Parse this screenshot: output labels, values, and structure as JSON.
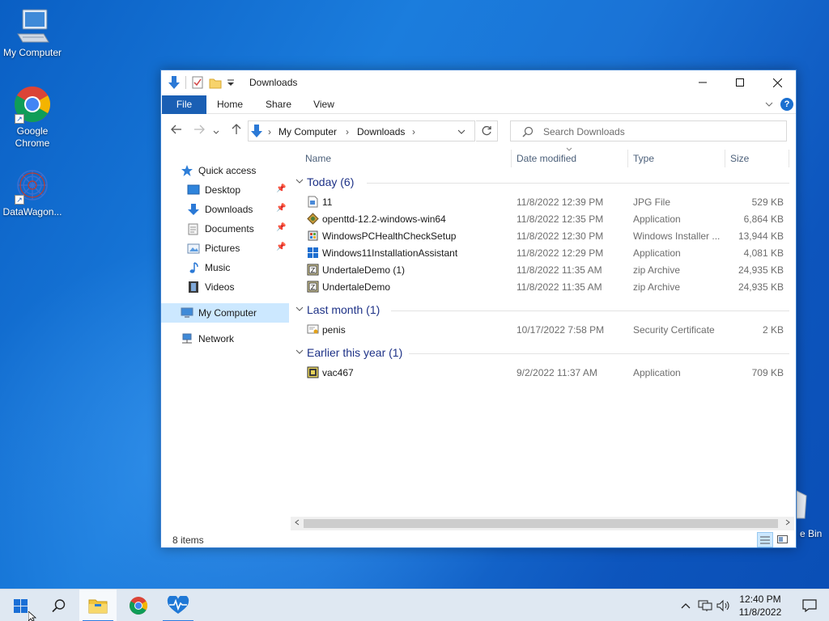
{
  "desktop": {
    "icons": [
      {
        "label": "My Computer"
      },
      {
        "label": "Google Chrome"
      },
      {
        "label": "DataWagon..."
      }
    ],
    "recycle_bin_label": "e Bin"
  },
  "window": {
    "title": "Downloads",
    "ribbon_tabs": [
      "File",
      "Home",
      "Share",
      "View"
    ],
    "help_glyph": "?",
    "address": {
      "crumbs": [
        "My Computer",
        "Downloads"
      ]
    },
    "search": {
      "placeholder": "Search Downloads"
    },
    "nav": {
      "quick_access": "Quick access",
      "items": [
        "Desktop",
        "Downloads",
        "Documents",
        "Pictures",
        "Music",
        "Videos"
      ],
      "my_computer": "My Computer",
      "network": "Network"
    },
    "columns": [
      "Name",
      "Date modified",
      "Type",
      "Size"
    ],
    "groups": [
      {
        "title": "Today (6)",
        "files": [
          {
            "name": "11",
            "date": "11/8/2022 12:39 PM",
            "type": "JPG File",
            "size": "529 KB",
            "icon": "image-file-icon"
          },
          {
            "name": "openttd-12.2-windows-win64",
            "date": "11/8/2022 12:35 PM",
            "type": "Application",
            "size": "6,864 KB",
            "icon": "installer-icon"
          },
          {
            "name": "WindowsPCHealthCheckSetup",
            "date": "11/8/2022 12:30 PM",
            "type": "Windows Installer ...",
            "size": "13,944 KB",
            "icon": "msi-icon"
          },
          {
            "name": "Windows11InstallationAssistant",
            "date": "11/8/2022 12:29 PM",
            "type": "Application",
            "size": "4,081 KB",
            "icon": "windows-logo-icon"
          },
          {
            "name": "UndertaleDemo (1)",
            "date": "11/8/2022 11:35 AM",
            "type": "zip Archive",
            "size": "24,935 KB",
            "icon": "zip-file-icon"
          },
          {
            "name": "UndertaleDemo",
            "date": "11/8/2022 11:35 AM",
            "type": "zip Archive",
            "size": "24,935 KB",
            "icon": "zip-file-icon"
          }
        ]
      },
      {
        "title": "Last month (1)",
        "files": [
          {
            "name": "penis",
            "date": "10/17/2022 7:58 PM",
            "type": "Security Certificate",
            "size": "2 KB",
            "icon": "certificate-icon"
          }
        ]
      },
      {
        "title": "Earlier this year (1)",
        "files": [
          {
            "name": "vac467",
            "date": "9/2/2022 11:37 AM",
            "type": "Application",
            "size": "709 KB",
            "icon": "application-icon"
          }
        ]
      }
    ],
    "status": {
      "item_count": "8 items"
    }
  },
  "taskbar": {
    "clock_time": "12:40 PM",
    "clock_date": "11/8/2022"
  },
  "colors": {
    "accent": "#1a5fb4",
    "group_title": "#1e3287",
    "selection": "#cce8ff",
    "taskbar": "#dfe8f2"
  }
}
